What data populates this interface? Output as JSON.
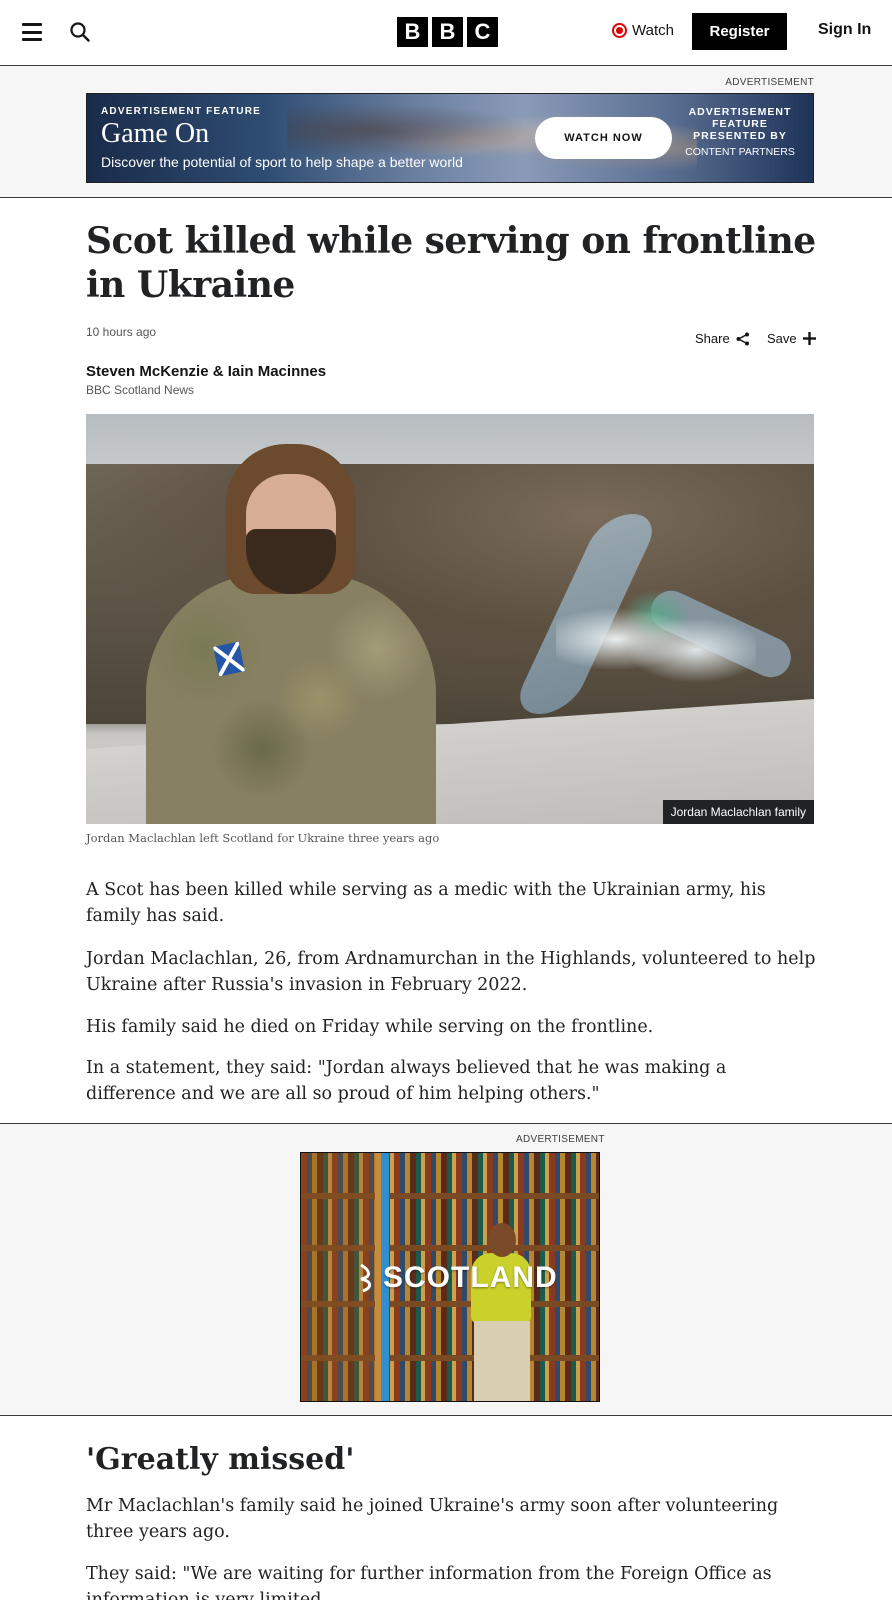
{
  "header": {
    "logo": [
      "B",
      "B",
      "C"
    ],
    "watch_label": "Watch",
    "register_label": "Register",
    "signin_label": "Sign In"
  },
  "ads": {
    "top_label": "ADVERTISEMENT",
    "top_banner": {
      "kicker": "ADVERTISEMENT FEATURE",
      "title": "Game On",
      "subtitle": "Discover the potential of sport to help shape a better world",
      "button": "WATCH NOW",
      "presented_by": "ADVERTISEMENT FEATURE PRESENTED BY",
      "partners": "CONTENT PARTNERS"
    },
    "mid_label": "ADVERTISEMENT",
    "mid_banner_logo": "SCOTLAND"
  },
  "article": {
    "headline": "Scot killed while serving on frontline in Ukraine",
    "timestamp": "10 hours ago",
    "share_label": "Share",
    "save_label": "Save",
    "authors": "Steven McKenzie & Iain Macinnes",
    "organisation": "BBC Scotland News",
    "image_credit": "Jordan Maclachlan family",
    "caption": "Jordan Maclachlan left Scotland for Ukraine three years ago",
    "paragraphs": [
      "A Scot has been killed while serving as a medic with the Ukrainian army, his family has said.",
      "Jordan Maclachlan, 26, from Ardnamurchan in the Highlands, volunteered to help Ukraine after Russia's invasion in February 2022.",
      "His family said he died on Friday while serving on the frontline.",
      "In a statement, they said: \"Jordan always believed that he was making a difference and we are all so proud of him helping others.\""
    ],
    "subheading": "'Greatly missed'",
    "paragraphs_2": [
      "Mr Maclachlan's family said he joined Ukraine's army soon after volunteering three years ago.",
      "They said: \"We are waiting for further information from the Foreign Office as information is very limited."
    ]
  },
  "icons": {
    "menu": "hamburger-menu-icon",
    "search": "search-icon",
    "watch": "live-dot-icon",
    "share": "share-icon",
    "save": "plus-icon"
  }
}
